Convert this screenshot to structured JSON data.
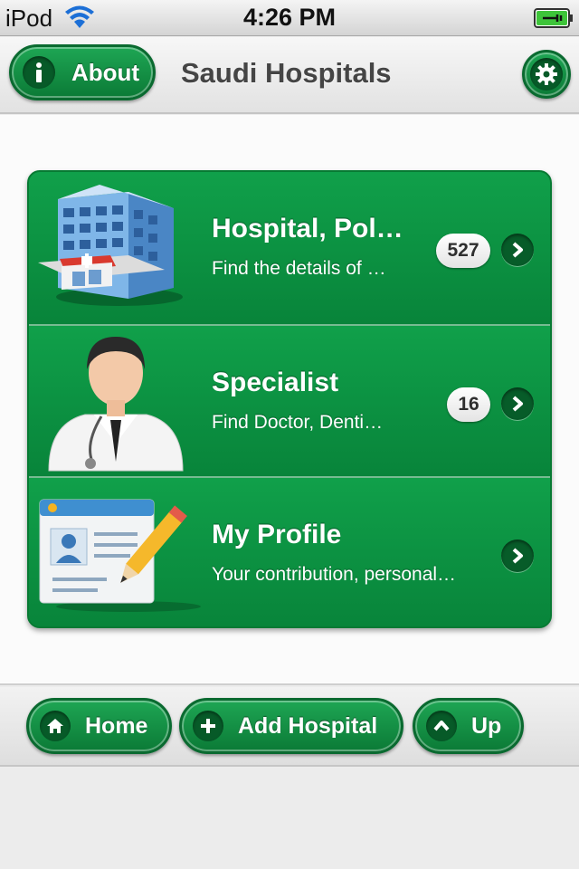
{
  "status_bar": {
    "carrier": "iPod",
    "time": "4:26 PM"
  },
  "nav": {
    "about_label": "About",
    "title": "Saudi Hospitals"
  },
  "menu": {
    "items": [
      {
        "title": "Hospital, Pol…",
        "subtitle": "Find the details of …",
        "count": "527",
        "image": "hospital-building-icon"
      },
      {
        "title": "Specialist",
        "subtitle": "Find Doctor, Denti…",
        "count": "16",
        "image": "doctor-icon"
      },
      {
        "title": "My Profile",
        "subtitle": "Your contribution, personal…",
        "count": "",
        "image": "profile-card-edit-icon"
      }
    ]
  },
  "toolbar": {
    "home_label": "Home",
    "add_label": "Add Hospital",
    "up_label": "Up"
  },
  "colors": {
    "accent_green": "#0b8a3c",
    "dark_green": "#075a28",
    "background": "#ececec"
  }
}
